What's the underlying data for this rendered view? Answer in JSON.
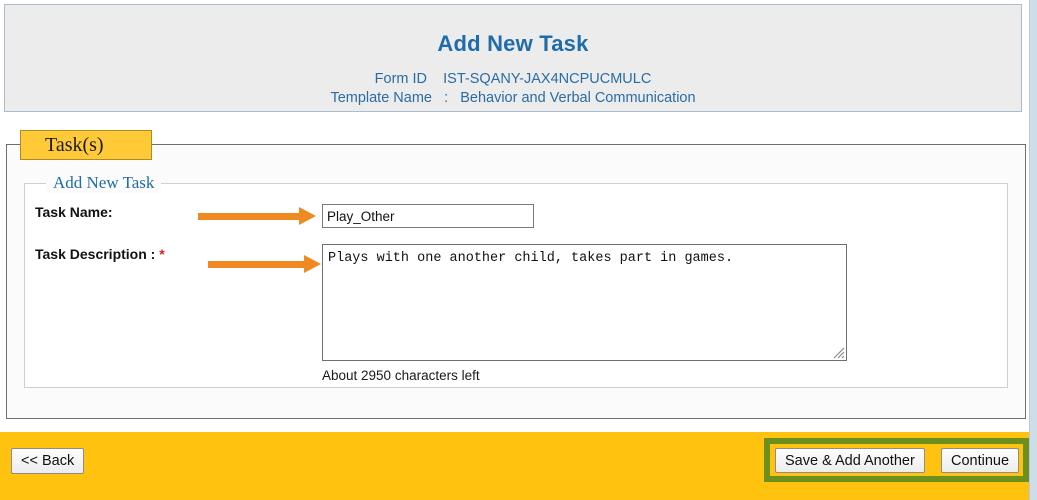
{
  "header": {
    "title": "Add New Task",
    "form_id_label": "Form ID",
    "form_id_value": "IST-SQANY-JAX4NCPUCMULC",
    "template_name_label": "Template Name",
    "template_name_separator": ":",
    "template_name_value": "Behavior and Verbal Communication"
  },
  "tab": {
    "label": "Task(s)"
  },
  "section": {
    "legend": "Add New Task"
  },
  "form": {
    "task_name_label": "Task Name:",
    "task_name_value": "Play_Other",
    "task_name_placeholder": "",
    "task_description_label": "Task Description :",
    "task_description_required_marker": "*",
    "task_description_value": "Plays with one another child, takes part in games.",
    "task_description_placeholder": "",
    "characters_left_text": "About 2950 characters left"
  },
  "footer": {
    "back_label": "<< Back",
    "save_add_another_label": "Save & Add Another",
    "continue_label": "Continue"
  },
  "colors": {
    "header_bg": "#ececec",
    "header_text": "#1f6cab",
    "tab_bg": "#ffc938",
    "footer_bg": "#ffc20e",
    "highlight_border": "#6f8f1c",
    "arrow": "#ef8a22",
    "required_star": "#e02020"
  }
}
